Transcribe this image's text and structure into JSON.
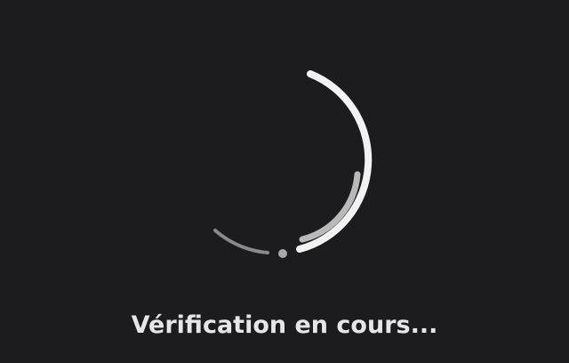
{
  "status": {
    "text": "Vérification en cours..."
  },
  "spinner": {
    "icon": "loading-spinner-icon",
    "colors": {
      "background": "#1c1c1e",
      "primary_arc": "#f2f2f2",
      "secondary_arc": "#b9b9b9",
      "faint_arc": "#8a8a8a"
    }
  }
}
